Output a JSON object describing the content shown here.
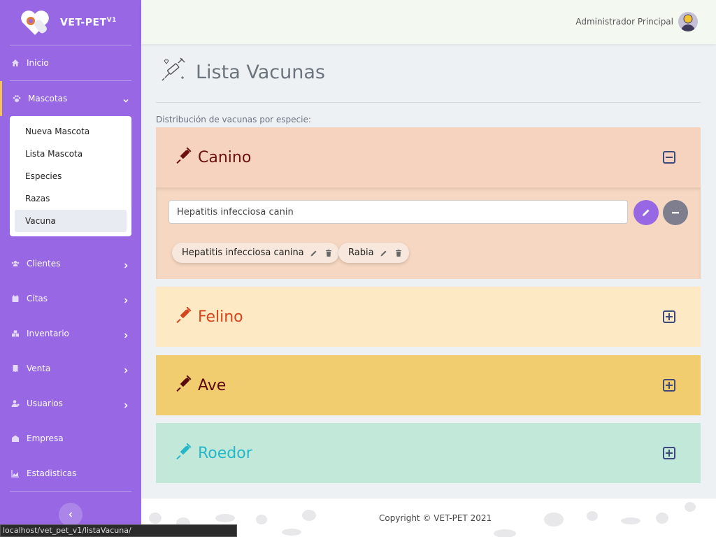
{
  "brand": {
    "name": "VET-PET",
    "version": "V1"
  },
  "sidebar": {
    "items": [
      {
        "label": "Inicio",
        "icon": "home-icon"
      },
      {
        "label": "Mascotas",
        "icon": "paw-icon",
        "expanded": true
      },
      {
        "label": "Clientes",
        "icon": "users-icon"
      },
      {
        "label": "Citas",
        "icon": "calendar-icon"
      },
      {
        "label": "Inventario",
        "icon": "boxes-icon"
      },
      {
        "label": "Venta",
        "icon": "receipt-icon"
      },
      {
        "label": "Usuarios",
        "icon": "user-gear-icon"
      },
      {
        "label": "Empresa",
        "icon": "building-icon"
      },
      {
        "label": "Estadisticas",
        "icon": "chart-area-icon"
      }
    ],
    "submenu": [
      "Nueva Mascota",
      "Lista Mascota",
      "Especies",
      "Razas",
      "Vacuna"
    ],
    "selected_sub": "Vacuna"
  },
  "header": {
    "user": "Administrador Principal"
  },
  "page": {
    "title": "Lista Vacunas",
    "subtitle": "Distribución de vacunas por especie:"
  },
  "panels": [
    {
      "title": "Canino",
      "color": "#6b0f0f",
      "bg": "#f6d3be",
      "expanded": true
    },
    {
      "title": "Felino",
      "color": "#d2451e",
      "bg": "#fde9c4",
      "expanded": false
    },
    {
      "title": "Ave",
      "color": "#5a0a0a",
      "bg": "#f2cd70",
      "expanded": false
    },
    {
      "title": "Roedor",
      "color": "#26b7c9",
      "bg": "#c1e8d8",
      "expanded": false
    }
  ],
  "canino": {
    "input_value": "Hepatitis infecciosa canin",
    "chips": [
      "Hepatitis infecciosa canina",
      "Rabia"
    ]
  },
  "footer": {
    "copyright": "Copyright © VET-PET 2021"
  },
  "statusbar": {
    "url": "localhost/vet_pet_v1/listaVacuna/"
  },
  "colors": {
    "sidebar": "#9867e4",
    "accent": "#f6c356"
  }
}
